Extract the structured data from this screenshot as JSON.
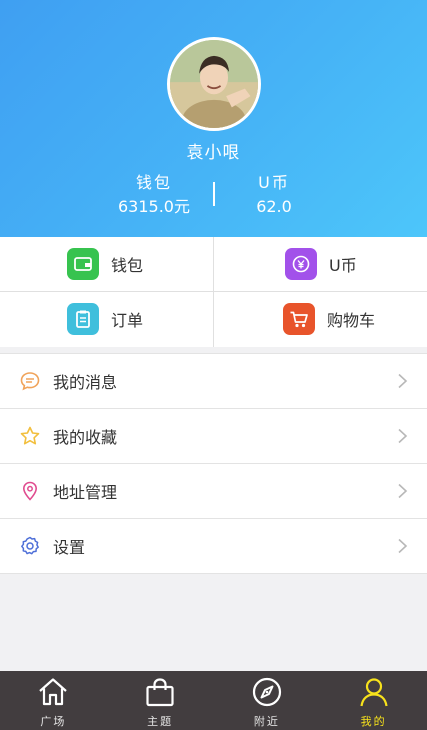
{
  "profile": {
    "username": "袁小哏",
    "wallet_label": "钱包",
    "wallet_value": "6315.0元",
    "coin_label": "U币",
    "coin_value": "62.0"
  },
  "grid": [
    {
      "label": "钱包",
      "icon": "wallet-icon",
      "color": "#37c34f"
    },
    {
      "label": "U币",
      "icon": "coin-icon",
      "color": "#a251ea"
    },
    {
      "label": "订单",
      "icon": "order-icon",
      "color": "#3fbfdc"
    },
    {
      "label": "购物车",
      "icon": "cart-icon",
      "color": "#e8542b"
    }
  ],
  "menu": [
    {
      "label": "我的消息",
      "icon": "message-icon",
      "color": "#f0a35a"
    },
    {
      "label": "我的收藏",
      "icon": "star-icon",
      "color": "#f2bf3e"
    },
    {
      "label": "地址管理",
      "icon": "location-icon",
      "color": "#e04b8f"
    },
    {
      "label": "设置",
      "icon": "settings-icon",
      "color": "#4e6fd8"
    }
  ],
  "tabs": [
    {
      "label": "广场",
      "icon": "home-icon",
      "active": false
    },
    {
      "label": "主题",
      "icon": "bag-icon",
      "active": false
    },
    {
      "label": "附近",
      "icon": "compass-icon",
      "active": false
    },
    {
      "label": "我的",
      "icon": "user-icon",
      "active": true
    }
  ],
  "colors": {
    "header_start": "#3f9ff2",
    "header_end": "#4dc6fa",
    "tabbar_bg": "#423d3f",
    "tab_active": "#f7e21c"
  }
}
